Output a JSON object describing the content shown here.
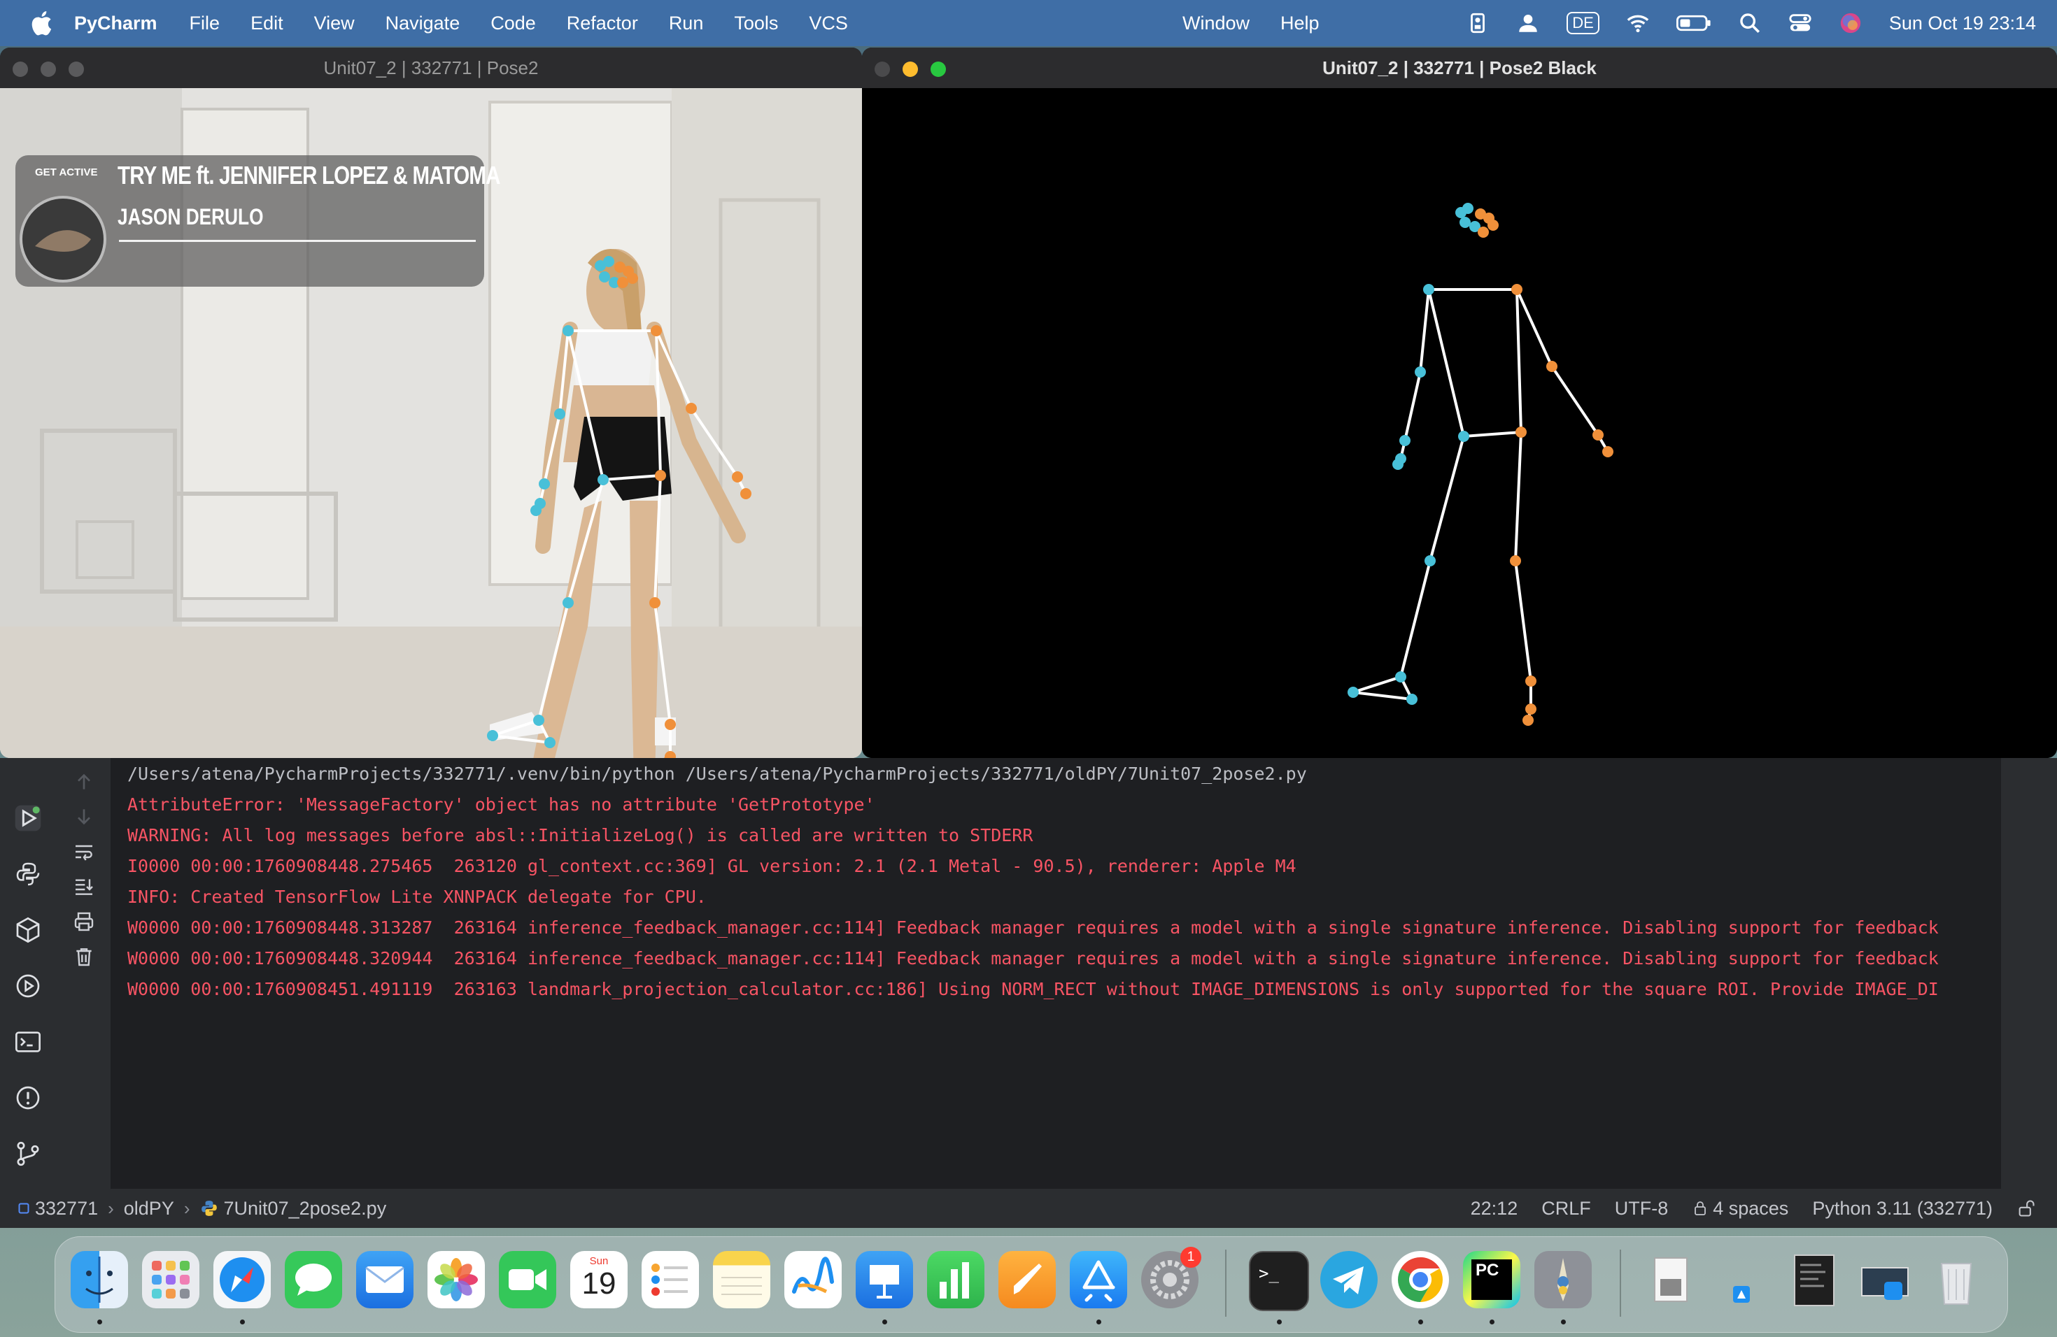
{
  "menubar": {
    "app_name": "PyCharm",
    "menus": [
      "File",
      "Edit",
      "View",
      "Navigate",
      "Code",
      "Refactor",
      "Run",
      "Tools",
      "VCS"
    ],
    "menus_right": [
      "Window",
      "Help"
    ],
    "input_source": "DE",
    "clock": "Sun Oct 19  23:14",
    "status_icons": [
      "dictation-icon",
      "user-icon",
      "input-source-icon",
      "wifi-icon",
      "battery-icon",
      "spotlight-icon",
      "control-center-icon",
      "siri-icon"
    ]
  },
  "windows": {
    "pose2": {
      "title": "Unit07_2 | 332771 | Pose2"
    },
    "pose2_black": {
      "title": "Unit07_2 | 332771 | Pose2 Black"
    }
  },
  "video_overlay": {
    "badge_text": "GET ACTIVE",
    "line1": "TRY ME ft. JENNIFER LOPEZ & MATOMA",
    "line2": "JASON DERULO"
  },
  "console": {
    "lines": [
      {
        "text": "/Users/atena/PycharmProjects/332771/.venv/bin/python /Users/atena/PycharmProjects/332771/oldPY/7Unit07_2pose2.py",
        "color": "#bcbec4"
      },
      {
        "text": "AttributeError: 'MessageFactory' object has no attribute 'GetPrototype'",
        "color": "#f75464"
      },
      {
        "text": "WARNING: All log messages before absl::InitializeLog() is called are written to STDERR",
        "color": "#f75464"
      },
      {
        "text": "I0000 00:00:1760908448.275465  263120 gl_context.cc:369] GL version: 2.1 (2.1 Metal - 90.5), renderer: Apple M4",
        "color": "#f75464"
      },
      {
        "text": "INFO: Created TensorFlow Lite XNNPACK delegate for CPU.",
        "color": "#f75464"
      },
      {
        "text": "W0000 00:00:1760908448.313287  263164 inference_feedback_manager.cc:114] Feedback manager requires a model with a single signature inference. Disabling support for feedback",
        "color": "#f75464"
      },
      {
        "text": "W0000 00:00:1760908448.320944  263164 inference_feedback_manager.cc:114] Feedback manager requires a model with a single signature inference. Disabling support for feedback",
        "color": "#f75464"
      },
      {
        "text": "W0000 00:00:1760908451.491119  263163 landmark_projection_calculator.cc:186] Using NORM_RECT without IMAGE_DIMENSIONS is only supported for the square ROI. Provide IMAGE_DI",
        "color": "#f75464"
      }
    ]
  },
  "toolwindows": [
    "run-icon",
    "python-console-icon",
    "python-packages-icon",
    "services-icon",
    "terminal-icon",
    "problems-icon",
    "git-icon"
  ],
  "console_actions": [
    "up-arrow-icon",
    "down-arrow-icon",
    "soft-wrap-icon",
    "scroll-to-end-icon",
    "print-icon",
    "trash-icon"
  ],
  "statusbar": {
    "project": "332771",
    "folder": "oldPY",
    "file": "7Unit07_2pose2.py",
    "position": "22:12",
    "line_sep": "CRLF",
    "encoding": "UTF-8",
    "indent": "4 spaces",
    "interpreter": "Python 3.11 (332771)"
  },
  "dock": {
    "apps": [
      "Finder",
      "Launchpad",
      "Safari",
      "Messages",
      "Mail",
      "Photos",
      "FaceTime",
      "Calendar",
      "Reminders",
      "Notes",
      "Freeform",
      "Keynote",
      "Numbers",
      "Pages",
      "App Store",
      "System Settings",
      "Terminal",
      "Telegram",
      "Chrome",
      "PyCharm",
      "Python Launcher",
      "Preview",
      "Downloads",
      "Documents",
      "Trash"
    ],
    "calendar_month": "Sun",
    "calendar_day": "19",
    "settings_badge": "1",
    "pycharm_label": "PC",
    "terminal_prompt": ">_",
    "colors": {
      "accent": "#3f6ea6",
      "error_text": "#f75464",
      "landmark_left": "#48c0d8",
      "landmark_right": "#f0903a"
    }
  }
}
